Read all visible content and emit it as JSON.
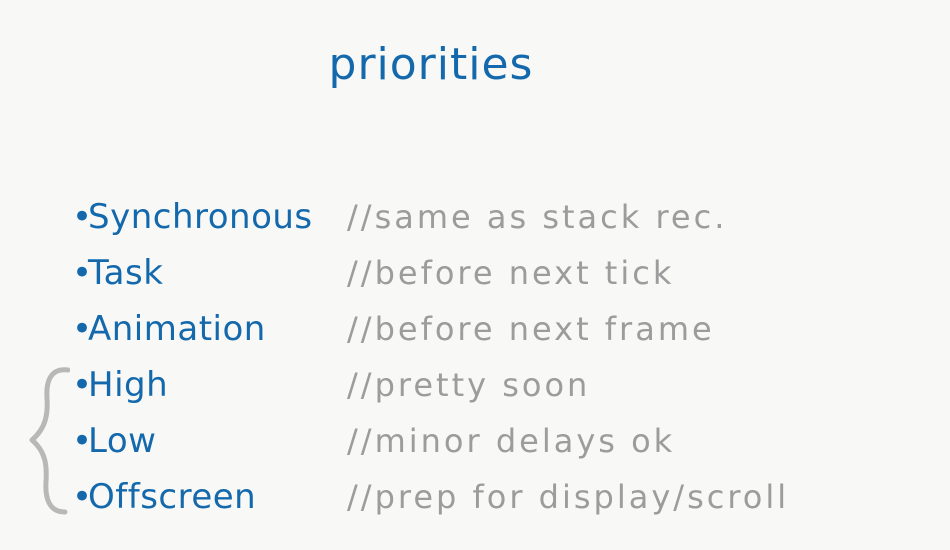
{
  "slide": {
    "title": "priorities",
    "rows": [
      {
        "bullet": "•",
        "term": "Synchronous",
        "comment": "//same as stack rec."
      },
      {
        "bullet": "•",
        "term": "Task",
        "comment": "//before next tick"
      },
      {
        "bullet": "•",
        "term": "Animation",
        "comment": "//before next frame"
      },
      {
        "bullet": "•",
        "term": "High",
        "comment": "//pretty soon"
      },
      {
        "bullet": "•",
        "term": "Low",
        "comment": "//minor delays ok"
      },
      {
        "bullet": "•",
        "term": "Offscreen",
        "comment": "//prep for display/scroll"
      }
    ]
  },
  "colors": {
    "term": "#1469ad",
    "comment": "#9c9c9c",
    "brace": "#b7b7b7",
    "background": "#f8f8f6"
  }
}
